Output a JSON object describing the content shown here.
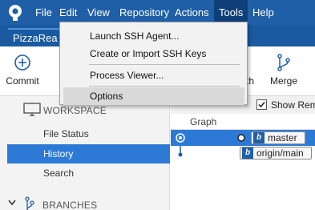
{
  "menubar": {
    "items": [
      "File",
      "Edit",
      "View",
      "Repository",
      "Actions",
      "Tools",
      "Help"
    ],
    "active": "Tools"
  },
  "tabs": {
    "repo": "PizzaRea"
  },
  "toolbar": {
    "commit": "Commit",
    "fetch_partial": "th",
    "merge": "Merge"
  },
  "tools_menu": {
    "items": [
      "Launch SSH Agent...",
      "Create or Import SSH Keys",
      "Process Viewer...",
      "Options"
    ],
    "highlighted": "Options"
  },
  "sidebar": {
    "workspace_header": "WORKSPACE",
    "items": [
      "File Status",
      "History",
      "Search"
    ],
    "selected": "History",
    "branches_header": "BRANCHES"
  },
  "history": {
    "show_remote_label": "Show Remo",
    "graph_column": "Graph",
    "refs": [
      "master",
      "origin/main"
    ]
  },
  "colors": {
    "accent": "#1f5fa7",
    "selection": "#2d7ad6",
    "menu_bg": "#f2f2f2"
  }
}
